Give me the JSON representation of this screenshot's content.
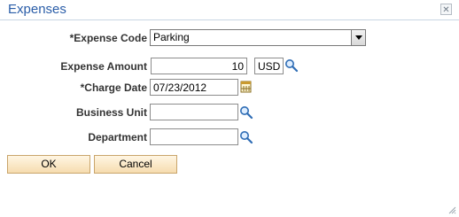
{
  "dialog": {
    "title": "Expenses",
    "close_icon": "close-icon",
    "close_glyph": "✕"
  },
  "form": {
    "expense_code": {
      "label": "*Expense Code",
      "value": "Parking"
    },
    "expense_amount": {
      "label": "Expense Amount",
      "value": "10",
      "currency": "USD"
    },
    "charge_date": {
      "label": "*Charge Date",
      "value": "07/23/2012"
    },
    "business_unit": {
      "label": "Business Unit",
      "value": ""
    },
    "department": {
      "label": "Department",
      "value": ""
    }
  },
  "buttons": {
    "ok": "OK",
    "cancel": "Cancel"
  },
  "icons": {
    "lookup": "search-icon",
    "calendar": "calendar-icon",
    "resize": "resize-grip-icon"
  },
  "colors": {
    "title": "#2a5da8",
    "button_bg": "#f6dcaf",
    "button_border": "#c9a56b"
  }
}
